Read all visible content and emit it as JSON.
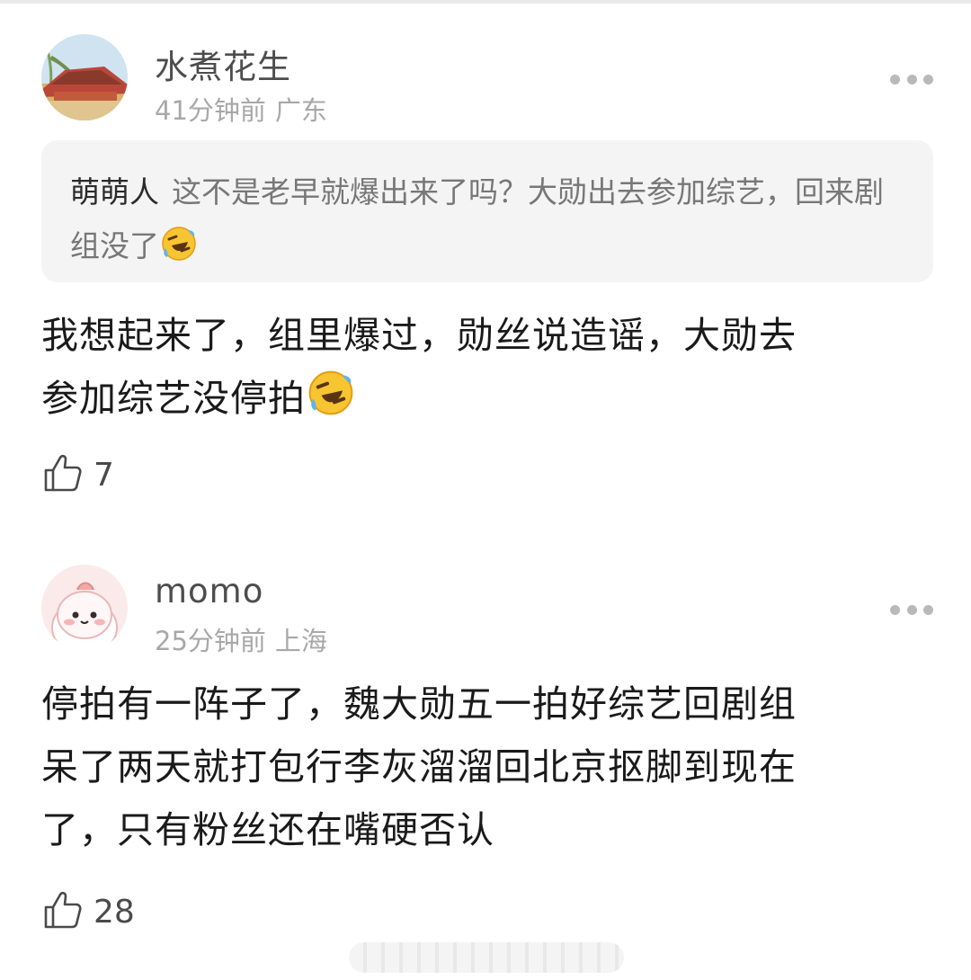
{
  "comments": [
    {
      "username": "水煮花生",
      "time": "41分钟前",
      "location": "广东",
      "quote": {
        "author": "萌萌人",
        "text": "这不是老早就爆出来了吗？大勋出去参加综艺，回来剧组没了"
      },
      "lines": [
        "我想起来了，组里爆过，勋丝说造谣，大勋去",
        "参加综艺没停拍"
      ],
      "likes": "7",
      "avatar": "palace-roof-avatar"
    },
    {
      "username": "momo",
      "time": "25分钟前",
      "location": "上海",
      "lines": [
        "停拍有一阵子了，魏大勋五一拍好综艺回剧组",
        "呆了两天就打包行李灰溜溜回北京抠脚到现在",
        "了，只有粉丝还在嘴硬否认"
      ],
      "likes": "28",
      "avatar": "pink-bunny-avatar"
    }
  ],
  "icons": {
    "more": "more-dots-icon",
    "like": "thumbs-up-icon",
    "emoji": "rolling-laughing-emoji"
  },
  "colors": {
    "username": "#4d4d4d",
    "meta": "#a8a8a8",
    "quote_bg": "#f4f4f4"
  }
}
